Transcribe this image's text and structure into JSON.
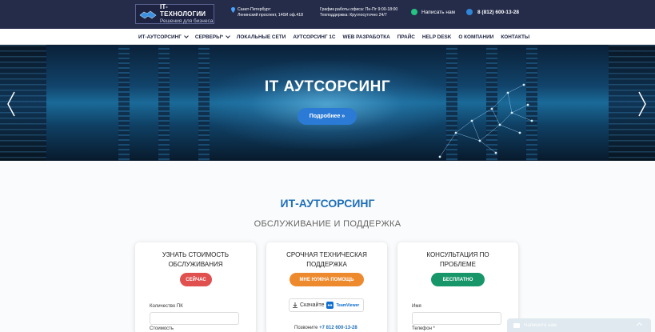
{
  "header": {
    "logo_title": "IT-ТЕХНОЛОГИИ",
    "logo_subtitle": "Решения для бизнеса",
    "address_line1": "Санкт-Петербург:",
    "address_line2": "Ленинский проспект, 140И оф.418",
    "hours_line1": "График работы офиса: Пн-Пт 9:00-18:00",
    "hours_line2": "Техподдержка: Круглосуточно 24/7",
    "write_us": "Написать нам",
    "phone": "8 (812) 600-13-28"
  },
  "nav": {
    "items": [
      {
        "label": "ИТ-АУТСОРСИНГ",
        "dropdown": true
      },
      {
        "label": "СЕРВЕРЫ*",
        "dropdown": true
      },
      {
        "label": "ЛОКАЛЬНЫЕ СЕТИ",
        "dropdown": false
      },
      {
        "label": "АУТСОРСИНГ 1С",
        "dropdown": false
      },
      {
        "label": "WEB РАЗРАБОТКА",
        "dropdown": false
      },
      {
        "label": "ПРАЙС",
        "dropdown": false
      },
      {
        "label": "HELP DESK",
        "dropdown": false
      },
      {
        "label": "О КОМПАНИИ",
        "dropdown": false
      },
      {
        "label": "КОНТАКТЫ",
        "dropdown": false
      }
    ]
  },
  "hero": {
    "title": "IT АУТСОРСИНГ",
    "button": "Подробнее »"
  },
  "section": {
    "title": "ИТ-АУТСОРСИНГ",
    "subtitle": "ОБСЛУЖИВАНИЕ И ПОДДЕРЖКА"
  },
  "cards": {
    "cost": {
      "title_line1": "УЗНАТЬ СТОИМОСТЬ",
      "title_line2": "ОБСЛУЖИВАНИЯ",
      "button": "СЕЙЧАС",
      "button_color": "#e0504f",
      "field1_label": "Количество ПК",
      "field2_label": "Стоимость"
    },
    "urgent": {
      "title_line1": "СРОЧНАЯ ТЕХНИЧЕСКАЯ",
      "title_line2": "ПОДДЕРЖКА",
      "button": "МНЕ НУЖНА ПОМОЩЬ",
      "button_color": "#ee8a2e",
      "download_label": "Скачайте",
      "teamviewer_label": "TeamViewer",
      "call_prefix": "Позвоните",
      "call_phone": "+7 812 600-13-28"
    },
    "consult": {
      "title_line1": "КОНСУЛЬТАЦИЯ ПО",
      "title_line2": "ПРОБЛЕМЕ",
      "button": "БЕСПЛАТНО",
      "button_color": "#17966a",
      "field1_label": "Имя",
      "field2_label": "Телефон *"
    }
  },
  "chat": {
    "label": "Напишите нам"
  },
  "colors": {
    "topbar": "#252c4a",
    "accent": "#1f6fb8",
    "hero_button": "#2b7bd6"
  }
}
